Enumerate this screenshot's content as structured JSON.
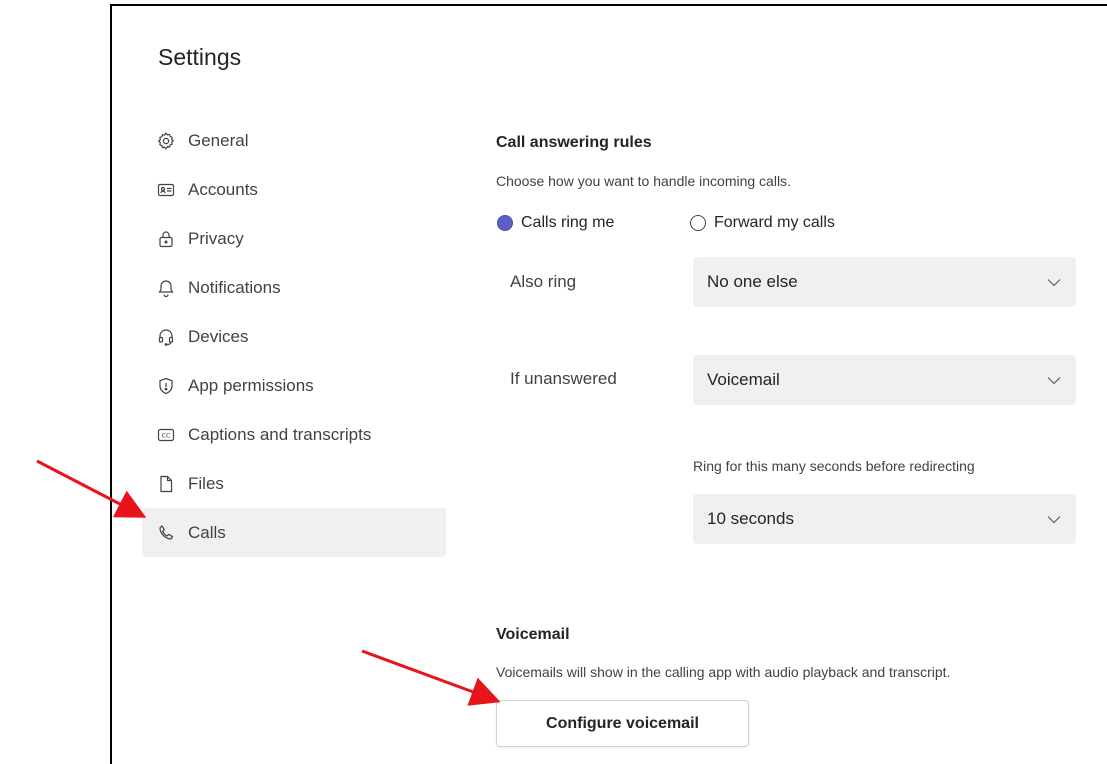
{
  "settings": {
    "title": "Settings",
    "nav": [
      {
        "label": "General",
        "icon": "gear-icon"
      },
      {
        "label": "Accounts",
        "icon": "id-card-icon"
      },
      {
        "label": "Privacy",
        "icon": "lock-icon"
      },
      {
        "label": "Notifications",
        "icon": "bell-icon"
      },
      {
        "label": "Devices",
        "icon": "headset-icon"
      },
      {
        "label": "App permissions",
        "icon": "shield-icon"
      },
      {
        "label": "Captions and transcripts",
        "icon": "cc-icon"
      },
      {
        "label": "Files",
        "icon": "file-icon"
      },
      {
        "label": "Calls",
        "icon": "phone-icon",
        "selected": true
      }
    ]
  },
  "call_rules": {
    "heading": "Call answering rules",
    "description": "Choose how you want to handle incoming calls.",
    "option_ring": "Calls ring me",
    "option_forward": "Forward my calls",
    "selected_option": "Calls ring me",
    "also_ring_label": "Also ring",
    "also_ring_value": "No one else",
    "unanswered_label": "If unanswered",
    "unanswered_value": "Voicemail",
    "ring_seconds_label": "Ring for this many seconds before redirecting",
    "ring_seconds_value": "10 seconds"
  },
  "voicemail": {
    "heading": "Voicemail",
    "description": "Voicemails will show in the calling app with audio playback and transcript.",
    "configure_button": "Configure voicemail"
  },
  "colors": {
    "accent": "#5b5fc7",
    "selected_bg": "#f0f0f0",
    "annotation_arrow": "#e8141c"
  }
}
